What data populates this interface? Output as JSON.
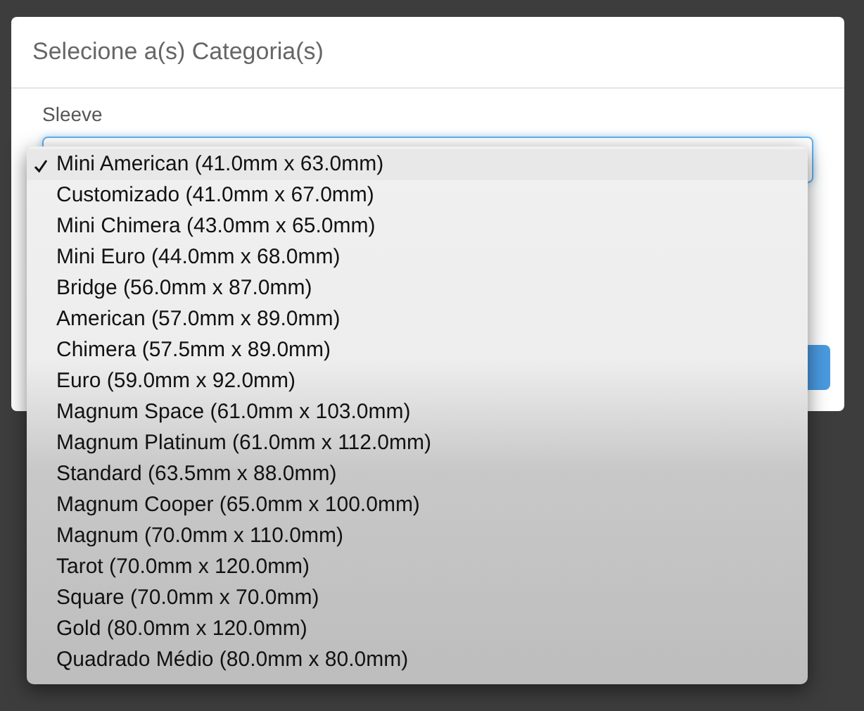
{
  "dialog": {
    "title": "Selecione a(s) Categoria(s)"
  },
  "field": {
    "label": "Sleeve"
  },
  "options": [
    {
      "label": "Mini American (41.0mm x 63.0mm)",
      "selected": true
    },
    {
      "label": "Customizado (41.0mm x 67.0mm)",
      "selected": false
    },
    {
      "label": "Mini Chimera (43.0mm x 65.0mm)",
      "selected": false
    },
    {
      "label": "Mini Euro (44.0mm x 68.0mm)",
      "selected": false
    },
    {
      "label": "Bridge (56.0mm x 87.0mm)",
      "selected": false
    },
    {
      "label": "American (57.0mm x 89.0mm)",
      "selected": false
    },
    {
      "label": "Chimera (57.5mm x 89.0mm)",
      "selected": false
    },
    {
      "label": "Euro (59.0mm x 92.0mm)",
      "selected": false
    },
    {
      "label": "Magnum Space (61.0mm x 103.0mm)",
      "selected": false
    },
    {
      "label": "Magnum Platinum (61.0mm x 112.0mm)",
      "selected": false
    },
    {
      "label": "Standard (63.5mm x 88.0mm)",
      "selected": false
    },
    {
      "label": "Magnum Cooper (65.0mm x 100.0mm)",
      "selected": false
    },
    {
      "label": "Magnum (70.0mm x 110.0mm)",
      "selected": false
    },
    {
      "label": "Tarot (70.0mm x 120.0mm)",
      "selected": false
    },
    {
      "label": "Square (70.0mm x 70.0mm)",
      "selected": false
    },
    {
      "label": "Gold (80.0mm x 120.0mm)",
      "selected": false
    },
    {
      "label": "Quadrado Médio (80.0mm x 80.0mm)",
      "selected": false
    }
  ]
}
